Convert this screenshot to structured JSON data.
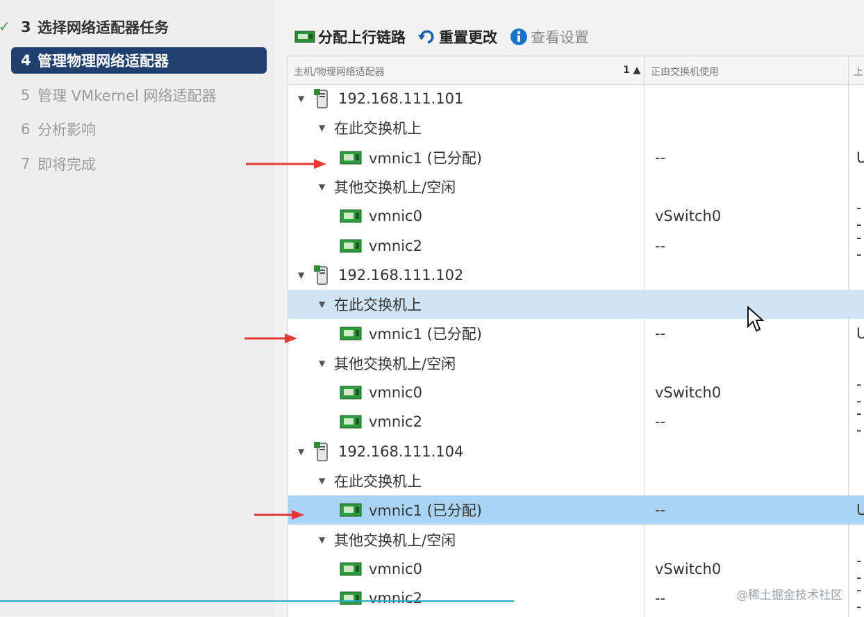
{
  "wizard": {
    "steps": [
      {
        "num": "3",
        "label": "选择网络适配器任务",
        "state": "done"
      },
      {
        "num": "4",
        "label": "管理物理网络适配器",
        "state": "active"
      },
      {
        "num": "5",
        "label": "管理 VMkernel 网络适配器",
        "state": "pending"
      },
      {
        "num": "6",
        "label": "分析影响",
        "state": "pending"
      },
      {
        "num": "7",
        "label": "即将完成",
        "state": "pending"
      }
    ],
    "check_glyph": "✓"
  },
  "toolbar": {
    "assign_uplink": "分配上行链路",
    "reset_changes": "重置更改",
    "view_settings": "查看设置"
  },
  "grid": {
    "headers": {
      "col1": "主机/物理网络适配器",
      "sort": "1 ▲",
      "col2": "正由交换机使用",
      "col3": "上"
    },
    "rows": [
      {
        "level": 0,
        "kind": "host",
        "label": "192.168.111.101",
        "col2": "",
        "col3": ""
      },
      {
        "level": 1,
        "kind": "group",
        "label": "在此交换机上",
        "col2": "",
        "col3": ""
      },
      {
        "level": 2,
        "kind": "nic",
        "label": "vmnic1 (已分配)",
        "col2": "--",
        "col3": "U"
      },
      {
        "level": 1,
        "kind": "group",
        "label": "其他交换机上/空闲",
        "col2": "",
        "col3": ""
      },
      {
        "level": 2,
        "kind": "nic",
        "label": "vmnic0",
        "col2": "vSwitch0",
        "col3": "--"
      },
      {
        "level": 2,
        "kind": "nic",
        "label": "vmnic2",
        "col2": "--",
        "col3": "--"
      },
      {
        "level": 0,
        "kind": "host",
        "label": "192.168.111.102",
        "col2": "",
        "col3": ""
      },
      {
        "level": 1,
        "kind": "group",
        "label": "在此交换机上",
        "col2": "",
        "col3": "",
        "state": "hover"
      },
      {
        "level": 2,
        "kind": "nic",
        "label": "vmnic1 (已分配)",
        "col2": "--",
        "col3": "U"
      },
      {
        "level": 1,
        "kind": "group",
        "label": "其他交换机上/空闲",
        "col2": "",
        "col3": ""
      },
      {
        "level": 2,
        "kind": "nic",
        "label": "vmnic0",
        "col2": "vSwitch0",
        "col3": "--"
      },
      {
        "level": 2,
        "kind": "nic",
        "label": "vmnic2",
        "col2": "--",
        "col3": "--"
      },
      {
        "level": 0,
        "kind": "host",
        "label": "192.168.111.104",
        "col2": "",
        "col3": ""
      },
      {
        "level": 1,
        "kind": "group",
        "label": "在此交换机上",
        "col2": "",
        "col3": ""
      },
      {
        "level": 2,
        "kind": "nic",
        "label": "vmnic1 (已分配)",
        "col2": "--",
        "col3": "U",
        "state": "selected"
      },
      {
        "level": 1,
        "kind": "group",
        "label": "其他交换机上/空闲",
        "col2": "",
        "col3": ""
      },
      {
        "level": 2,
        "kind": "nic",
        "label": "vmnic0",
        "col2": "vSwitch0",
        "col3": "--"
      },
      {
        "level": 2,
        "kind": "nic",
        "label": "vmnic2",
        "col2": "--",
        "col3": "--"
      }
    ]
  },
  "watermark": "@稀土掘金技术社区",
  "colors": {
    "active_step": "#1f3f6e",
    "selected_row": "#a9d4f5",
    "hover_row": "#cfe5f5",
    "arrow": "#e53935"
  }
}
